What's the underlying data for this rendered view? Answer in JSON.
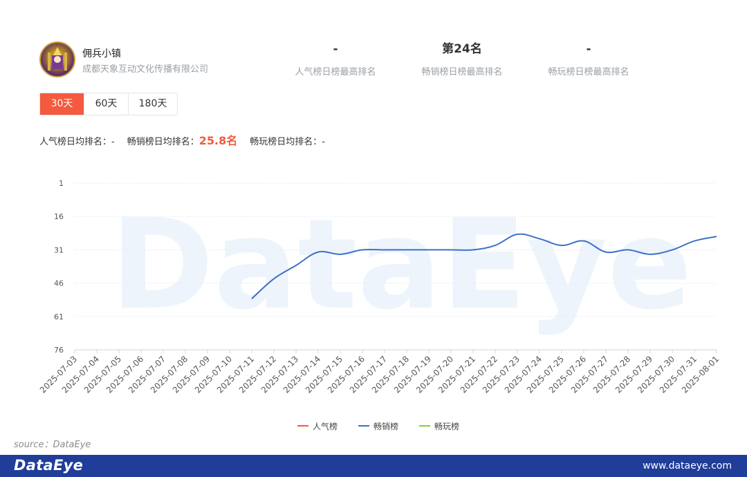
{
  "app": {
    "name": "佣兵小镇",
    "company": "成都天象互动文化传播有限公司"
  },
  "stats": [
    {
      "value": "-",
      "label": "人气榜日榜最高排名"
    },
    {
      "value": "第24名",
      "label": "畅销榜日榜最高排名"
    },
    {
      "value": "-",
      "label": "畅玩榜日榜最高排名"
    }
  ],
  "tabs": [
    {
      "label": "30天",
      "active": true
    },
    {
      "label": "60天",
      "active": false
    },
    {
      "label": "180天",
      "active": false
    }
  ],
  "averages": {
    "popular_label": "人气榜日均排名：",
    "popular_value": "-",
    "sales_label": "畅销榜日均排名：",
    "sales_value": "25.8名",
    "play_label": "畅玩榜日均排名：",
    "play_value": "-"
  },
  "watermark": "DataEye",
  "source": "source：DataEye",
  "footer": {
    "logo": "DataEye",
    "url": "www.dataeye.com"
  },
  "colors": {
    "accent": "#f35a3e",
    "sales_line": "#3a70c9",
    "popular_line": "#f35a3e",
    "play_line": "#7ed321",
    "footer_bg": "#1f3d99"
  },
  "chart_data": {
    "type": "line",
    "y_reversed": true,
    "ylim": [
      1,
      76
    ],
    "yticks": [
      1,
      16,
      31,
      46,
      61,
      76
    ],
    "grid": true,
    "legend_position": "bottom-center",
    "categories": [
      "2025-07-03",
      "2025-07-04",
      "2025-07-05",
      "2025-07-06",
      "2025-07-07",
      "2025-07-08",
      "2025-07-09",
      "2025-07-10",
      "2025-07-11",
      "2025-07-12",
      "2025-07-13",
      "2025-07-14",
      "2025-07-15",
      "2025-07-16",
      "2025-07-17",
      "2025-07-18",
      "2025-07-19",
      "2025-07-20",
      "2025-07-21",
      "2025-07-22",
      "2025-07-23",
      "2025-07-24",
      "2025-07-25",
      "2025-07-26",
      "2025-07-27",
      "2025-07-28",
      "2025-07-29",
      "2025-07-30",
      "2025-07-31",
      "2025-08-01"
    ],
    "series": [
      {
        "name": "人气榜",
        "values": [
          null,
          null,
          null,
          null,
          null,
          null,
          null,
          null,
          null,
          null,
          null,
          null,
          null,
          null,
          null,
          null,
          null,
          null,
          null,
          null,
          null,
          null,
          null,
          null,
          null,
          null,
          null,
          null,
          null,
          null
        ]
      },
      {
        "name": "畅销榜",
        "values": [
          null,
          null,
          null,
          null,
          null,
          null,
          null,
          null,
          53,
          44,
          38,
          32,
          33,
          31,
          31,
          31,
          31,
          31,
          31,
          29,
          24,
          26,
          29,
          27,
          32,
          31,
          33,
          31,
          27,
          25
        ]
      },
      {
        "name": "畅玩榜",
        "values": [
          null,
          null,
          null,
          null,
          null,
          null,
          null,
          null,
          null,
          null,
          null,
          null,
          null,
          null,
          null,
          null,
          null,
          null,
          null,
          null,
          null,
          null,
          null,
          null,
          null,
          null,
          null,
          null,
          null,
          null
        ]
      }
    ]
  }
}
